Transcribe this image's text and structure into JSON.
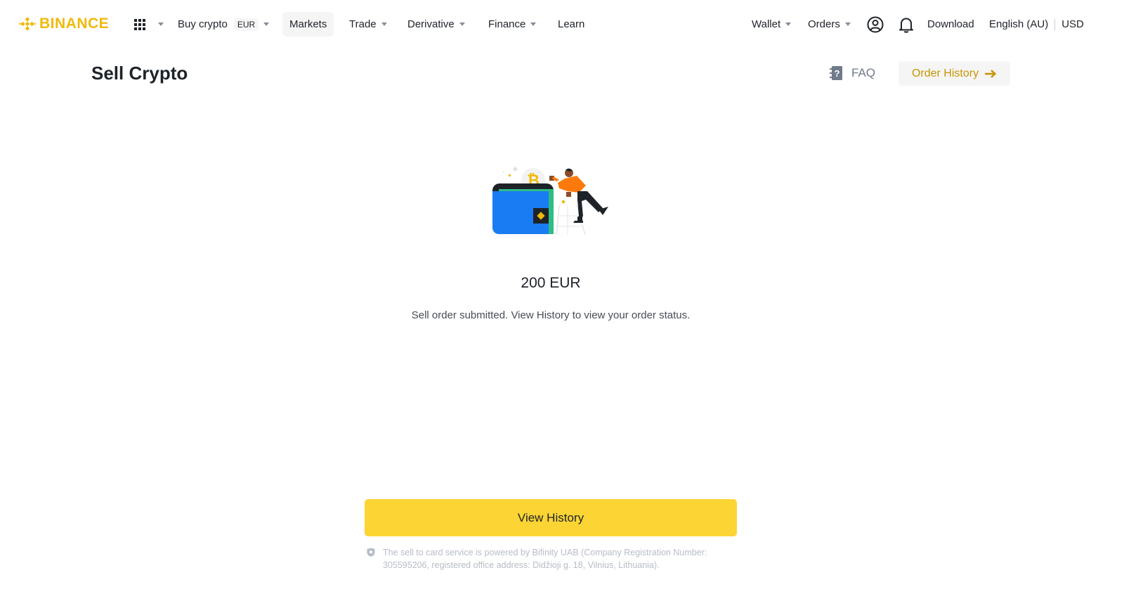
{
  "brand": {
    "name": "BINANCE",
    "color": "#F0B90B"
  },
  "nav": {
    "left": [
      {
        "label": "Buy crypto",
        "badge": "EUR",
        "has_caret": true
      },
      {
        "label": "Markets",
        "has_caret": false,
        "active": true
      },
      {
        "label": "Trade",
        "has_caret": true
      },
      {
        "label": "Derivative",
        "has_caret": true
      },
      {
        "label": "Finance",
        "has_caret": true
      },
      {
        "label": "Learn",
        "has_caret": false
      }
    ],
    "right": {
      "wallet": "Wallet",
      "orders": "Orders",
      "profile_icon": "user-circle-icon",
      "notifications_icon": "bell-icon",
      "download": "Download",
      "language": "English (AU)",
      "currency": "USD"
    }
  },
  "header": {
    "title": "Sell Crypto",
    "faq": "FAQ",
    "order_history": "Order History"
  },
  "result": {
    "amount": "200 EUR",
    "message": "Sell order submitted. View History to view your order status."
  },
  "actions": {
    "view_history": "View History"
  },
  "footer": {
    "disclaimer": "The sell to card service is powered by Bifinity UAB (Company Registration Number: 305595206, registered office address: Didžioji g. 18, Vilnius, Lithuania)."
  },
  "colors": {
    "accent": "#FCD535",
    "link": "#C99400",
    "text": "#1E2329",
    "muted": "#707A8A"
  }
}
